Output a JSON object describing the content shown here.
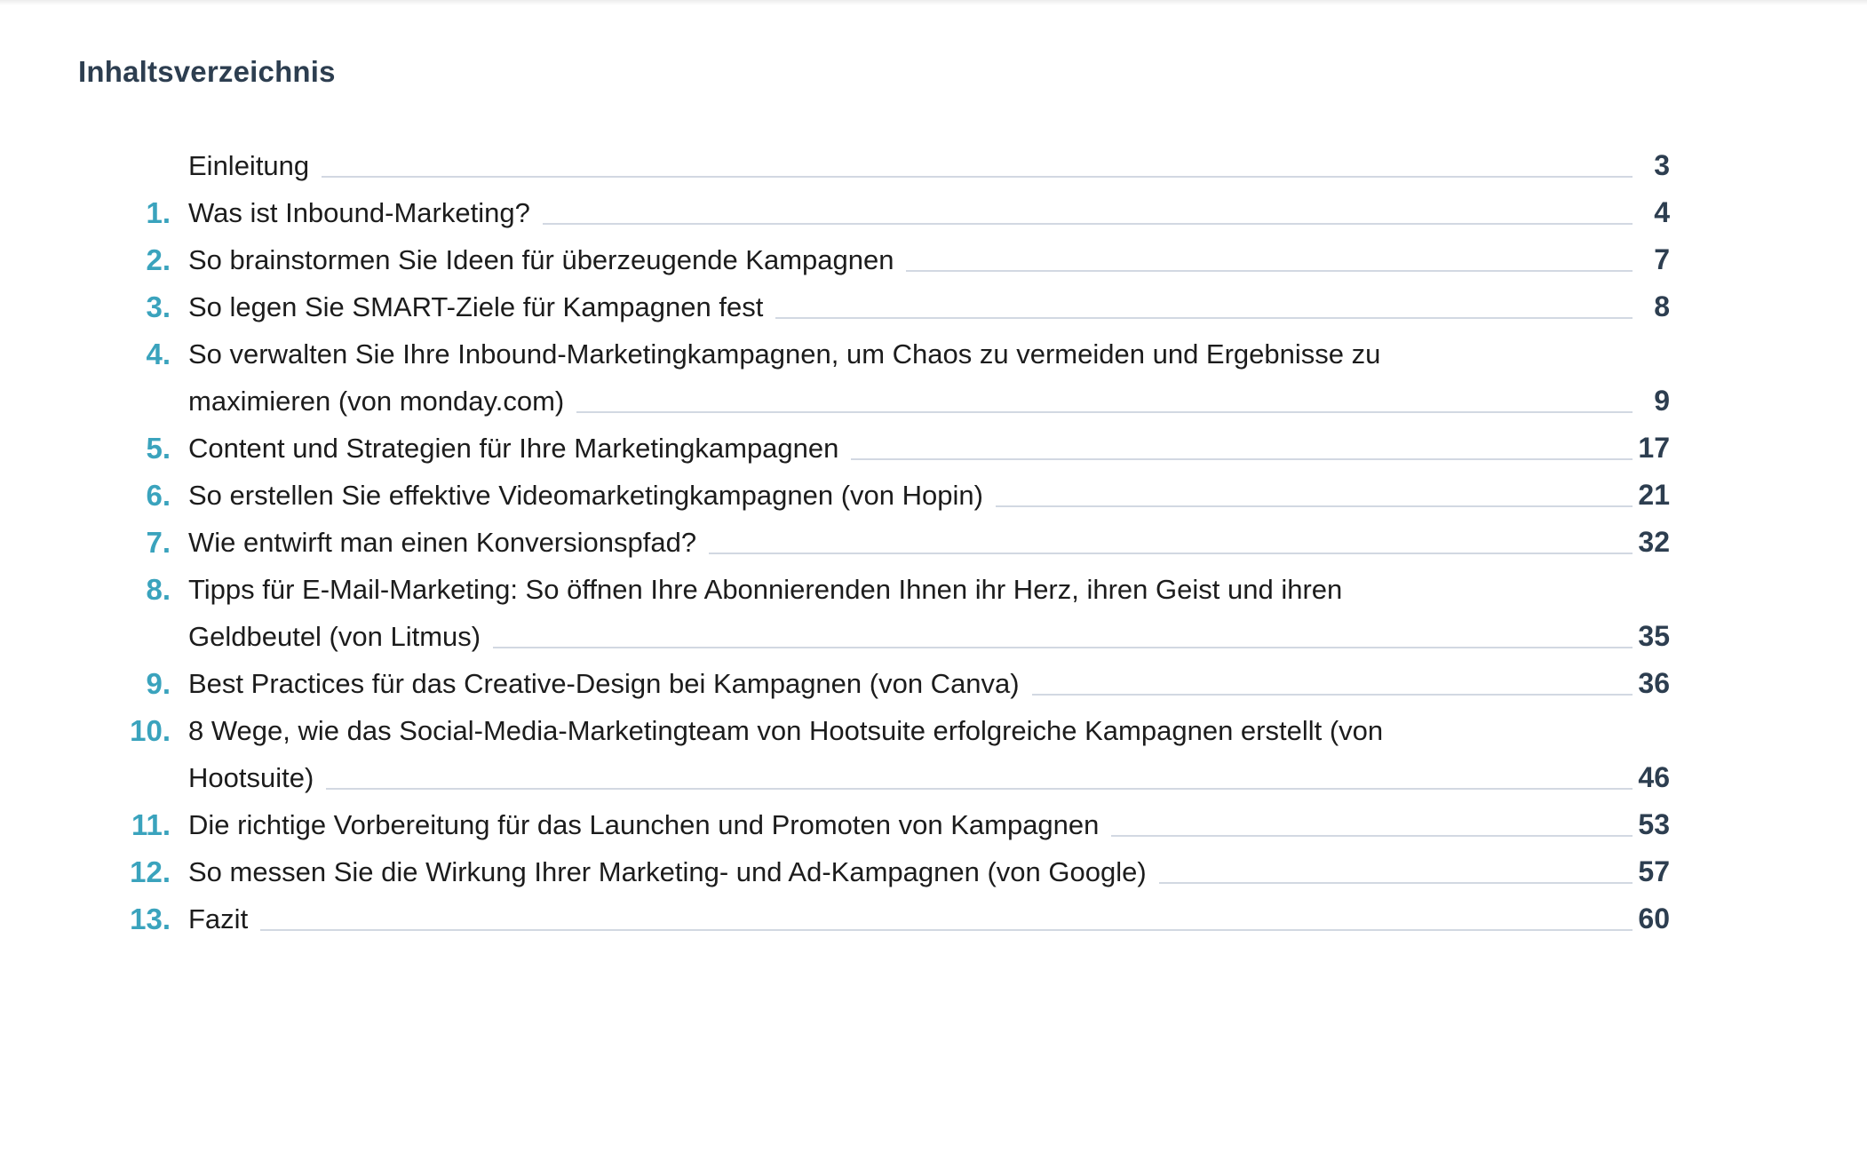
{
  "title": "Inhaltsverzeichnis",
  "entries": [
    {
      "number": "",
      "lines": [
        "Einleitung"
      ],
      "page": "3"
    },
    {
      "number": "1.",
      "lines": [
        "Was ist Inbound-Marketing?"
      ],
      "page": "4"
    },
    {
      "number": "2.",
      "lines": [
        "So brainstormen Sie Ideen für überzeugende Kampagnen"
      ],
      "page": "7"
    },
    {
      "number": "3.",
      "lines": [
        "So legen Sie SMART-Ziele für Kampagnen fest"
      ],
      "page": "8"
    },
    {
      "number": "4.",
      "lines": [
        "So verwalten Sie Ihre Inbound-Marketingkampagnen, um Chaos zu vermeiden und Ergebnisse zu",
        "maximieren (von monday.com)"
      ],
      "page": "9"
    },
    {
      "number": "5.",
      "lines": [
        "Content und Strategien für Ihre Marketingkampagnen"
      ],
      "page": "17"
    },
    {
      "number": "6.",
      "lines": [
        "So erstellen Sie effektive Videomarketingkampagnen (von Hopin)"
      ],
      "page": "21"
    },
    {
      "number": "7.",
      "lines": [
        "Wie entwirft man einen Konversionspfad?"
      ],
      "page": "32"
    },
    {
      "number": "8.",
      "lines": [
        "Tipps für E-Mail-Marketing: So öffnen Ihre Abonnierenden Ihnen ihr Herz, ihren Geist und ihren",
        "Geldbeutel (von Litmus)"
      ],
      "page": "35"
    },
    {
      "number": "9.",
      "lines": [
        "Best Practices für das Creative-Design bei Kampagnen (von Canva)"
      ],
      "page": "36"
    },
    {
      "number": "10.",
      "lines": [
        "8 Wege, wie das Social-Media-Marketingteam von Hootsuite erfolgreiche Kampagnen erstellt (von",
        "Hootsuite)"
      ],
      "page": "46"
    },
    {
      "number": "11.",
      "lines": [
        "Die richtige Vorbereitung für das Launchen und Promoten von Kampagnen"
      ],
      "page": "53"
    },
    {
      "number": "12.",
      "lines": [
        "So messen Sie die Wirkung Ihrer Marketing- und Ad-Kampagnen (von Google)"
      ],
      "page": "57"
    },
    {
      "number": "13.",
      "lines": [
        "Fazit"
      ],
      "page": "60"
    }
  ],
  "colors": {
    "number": "#3aa3bd",
    "title": "#2d3e50",
    "page": "#2d3e50",
    "text": "#1c1c1c",
    "leader": "#d2d8e2"
  }
}
